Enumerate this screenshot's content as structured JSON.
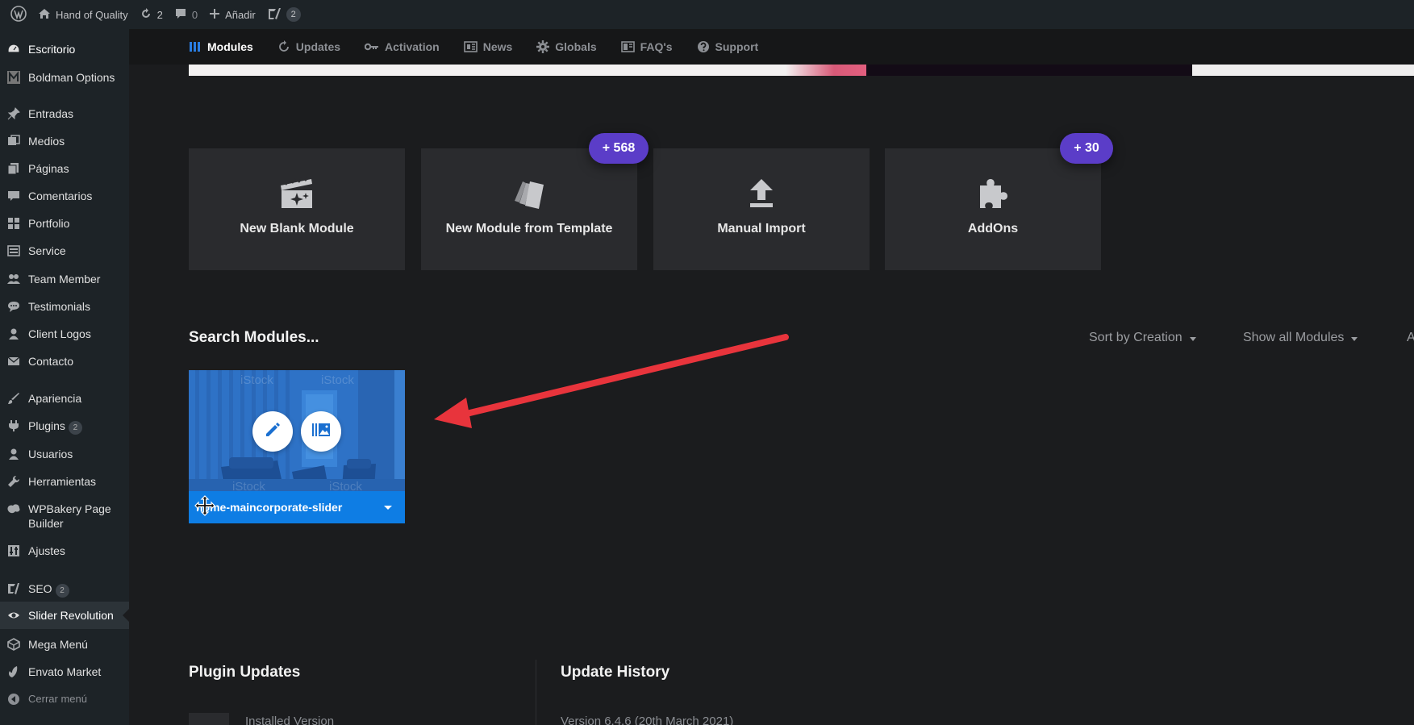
{
  "adminbar": {
    "site_name": "Hand of Quality",
    "updates_count": "2",
    "comments_count": "0",
    "add_label": "Añadir",
    "seo_count": "2"
  },
  "sidebar": {
    "items": [
      {
        "label": "Escritorio",
        "icon": "dashboard-icon"
      },
      {
        "label": "Boldman Options",
        "icon": "boldman-icon"
      },
      {
        "label": "Entradas",
        "icon": "pin-icon"
      },
      {
        "label": "Medios",
        "icon": "media-icon"
      },
      {
        "label": "Páginas",
        "icon": "pages-icon"
      },
      {
        "label": "Comentarios",
        "icon": "comments-icon"
      },
      {
        "label": "Portfolio",
        "icon": "grid-icon"
      },
      {
        "label": "Service",
        "icon": "service-icon"
      },
      {
        "label": "Team Member",
        "icon": "team-icon"
      },
      {
        "label": "Testimonials",
        "icon": "testimonials-icon"
      },
      {
        "label": "Client Logos",
        "icon": "client-icon"
      },
      {
        "label": "Contacto",
        "icon": "mail-icon"
      },
      {
        "label": "Apariencia",
        "icon": "appearance-icon"
      },
      {
        "label": "Plugins",
        "icon": "plugins-icon",
        "badge": "2"
      },
      {
        "label": "Usuarios",
        "icon": "users-icon"
      },
      {
        "label": "Herramientas",
        "icon": "tools-icon"
      },
      {
        "label": "WPBakery Page Builder",
        "icon": "wpbakery-icon"
      },
      {
        "label": "Ajustes",
        "icon": "settings-icon"
      },
      {
        "label": "SEO",
        "icon": "yoast-icon",
        "badge": "2"
      },
      {
        "label": "Slider Revolution",
        "icon": "revslider-icon"
      },
      {
        "label": "Mega Menú",
        "icon": "megamenu-icon"
      },
      {
        "label": "Envato Market",
        "icon": "envato-icon"
      },
      {
        "label": "Cerrar menú",
        "icon": "collapse-icon"
      }
    ]
  },
  "tabs": [
    {
      "label": "Modules",
      "icon": "modules-icon"
    },
    {
      "label": "Updates",
      "icon": "updates-icon"
    },
    {
      "label": "Activation",
      "icon": "key-icon"
    },
    {
      "label": "News",
      "icon": "news-icon"
    },
    {
      "label": "Globals",
      "icon": "gear-icon"
    },
    {
      "label": "FAQ's",
      "icon": "faq-icon"
    },
    {
      "label": "Support",
      "icon": "support-icon"
    }
  ],
  "cards": [
    {
      "label": "New Blank Module",
      "icon": "clapper-sparkle-icon"
    },
    {
      "label": "New Module from Template",
      "icon": "template-cards-icon",
      "badge": "+ 568"
    },
    {
      "label": "Manual Import",
      "icon": "upload-icon"
    },
    {
      "label": "AddOns",
      "icon": "puzzle-icon",
      "badge": "+ 30"
    }
  ],
  "search": {
    "title": "Search Modules...",
    "sort_label": "Sort by Creation",
    "filter_label": "Show all Modules",
    "trailing_letter": "A"
  },
  "module": {
    "name": "home-maincorporate-slider",
    "watermark": "iStock"
  },
  "bottom": {
    "plugin_updates_title": "Plugin Updates",
    "update_history_title": "Update History",
    "installed_version_label": "Installed Version",
    "history_entry": "Version 6.4.6 (20th March 2021)"
  },
  "colors": {
    "accent": "#0e7de4",
    "badge_purple": "#5b3dc8",
    "arrow_red": "#e8343c"
  }
}
